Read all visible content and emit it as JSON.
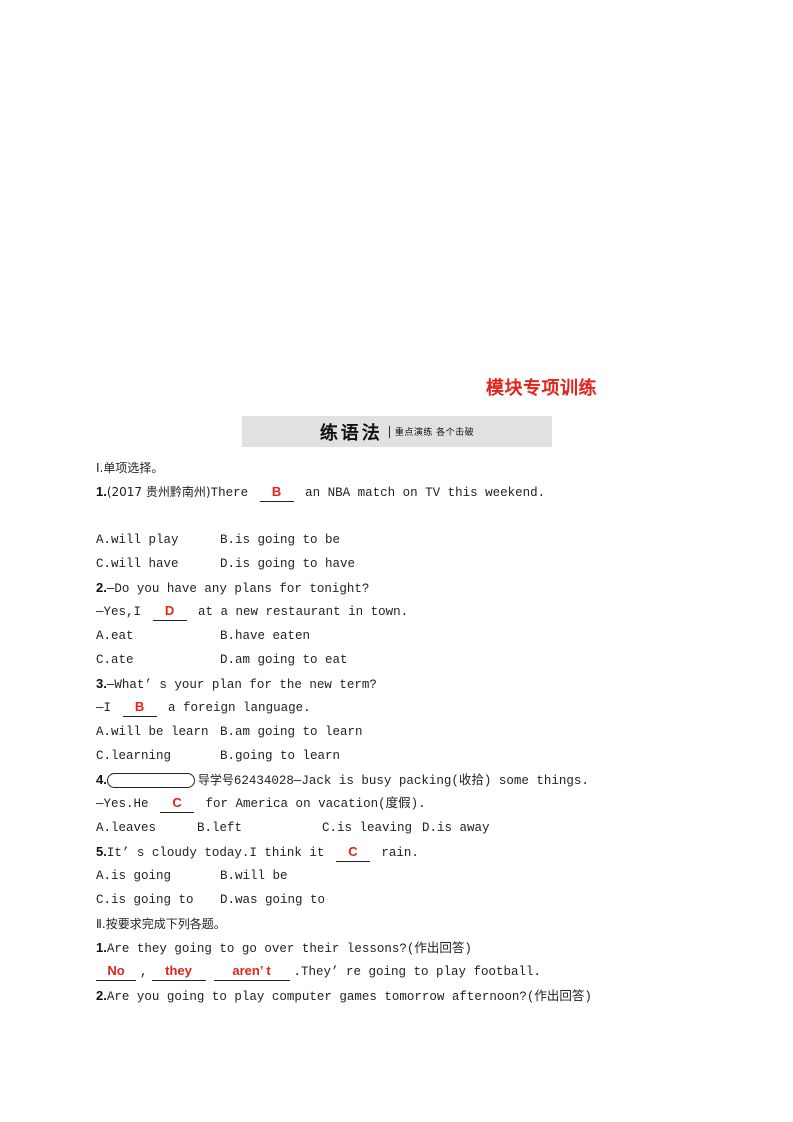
{
  "module_title": "模块专项训练",
  "section_bar": {
    "title": "练语法",
    "subtitle": "重点演练 各个击破"
  },
  "part1": {
    "heading": "Ⅰ.单项选择。",
    "questions": [
      {
        "num": "1.",
        "source": "(2017 贵州黔南州)",
        "before": "There",
        "answer": "B",
        "after": "an NBA match on TV this weekend.",
        "options": [
          "A.will play",
          "B.is going to be",
          "C.will have",
          "D.is going to have"
        ]
      },
      {
        "num": "2.",
        "line1": "—Do you have any plans for tonight?",
        "before": "—Yes,I",
        "answer": "D",
        "after": "at a new restaurant in town.",
        "options": [
          "A.eat",
          "B.have eaten",
          "C.ate",
          "D.am going to eat"
        ]
      },
      {
        "num": "3.",
        "line1": "—What’ s your plan for the new term?",
        "before": "—I",
        "answer": "B",
        "after": "a foreign language.",
        "options": [
          "A.will be learn",
          "B.am going to learn",
          "C.learning",
          "B.going to learn"
        ]
      },
      {
        "num": "4.",
        "guide_label": "导学号",
        "guide_number": "62434028",
        "line1": "—Jack is busy packing(收拾) some things.",
        "before": "—Yes.He",
        "answer": "C",
        "after": "for America on vacation(度假).",
        "options": [
          "A.leaves",
          "B.left",
          "C.is leaving",
          "D.is away"
        ]
      },
      {
        "num": "5.",
        "before": "It’ s cloudy today.I think it",
        "answer": "C",
        "after": "rain.",
        "options": [
          "A.is going",
          "B.will be",
          "C.is going to",
          "D.was going to"
        ]
      }
    ]
  },
  "part2": {
    "heading": "Ⅱ.按要求完成下列各题。",
    "questions": [
      {
        "num": "1.",
        "text": "Are they going to go over their lessons?(作出回答)",
        "answers": [
          "No",
          "they",
          "aren’ t"
        ],
        "after": ".They’ re going to play football."
      },
      {
        "num": "2.",
        "text": "Are you going to play computer games tomorrow afternoon?(作出回答)"
      }
    ]
  },
  "colors": {
    "answer_red": "#e4231c",
    "section_bar_bg": "#e1e1e1"
  }
}
